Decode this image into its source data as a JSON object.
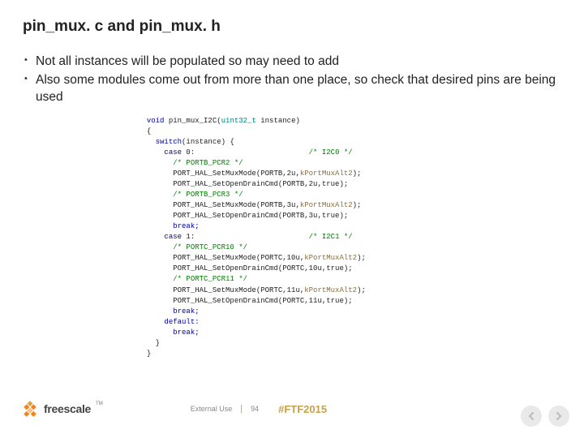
{
  "title": "pin_mux. c and pin_mux. h",
  "bullets": [
    "Not all instances will be populated so may need to add",
    "Also some modules come out from more than one place, so check that desired pins are being used"
  ],
  "code": {
    "l1a": "void",
    "l1b": " pin_mux_I2C(",
    "l1c": "uint32_t",
    "l1d": " instance)",
    "l2": "{",
    "l3a": "  switch",
    "l3b": "(instance) {",
    "l4a": "    case",
    "l4b": " 0:",
    "l4c": "                          /* I2C0 */",
    "l5": "      /* PORTB_PCR2 */",
    "l6a": "      PORT_HAL_SetMuxMode(PORTB,2u,",
    "l6b": "kPortMuxAlt2",
    "l6c": ");",
    "l7": "      PORT_HAL_SetOpenDrainCmd(PORTB,2u,true);",
    "l8": "      /* PORTB_PCR3 */",
    "l9a": "      PORT_HAL_SetMuxMode(PORTB,3u,",
    "l9b": "kPortMuxAlt2",
    "l9c": ");",
    "l10": "      PORT_HAL_SetOpenDrainCmd(PORTB,3u,true);",
    "l11": "      break;",
    "l12a": "    case",
    "l12b": " 1:",
    "l12c": "                          /* I2C1 */",
    "l13": "      /* PORTC_PCR10 */",
    "l14a": "      PORT_HAL_SetMuxMode(PORTC,10u,",
    "l14b": "kPortMuxAlt2",
    "l14c": ");",
    "l15": "      PORT_HAL_SetOpenDrainCmd(PORTC,10u,true);",
    "l16": "      /* PORTC_PCR11 */",
    "l17a": "      PORT_HAL_SetMuxMode(PORTC,11u,",
    "l17b": "kPortMuxAlt2",
    "l17c": ");",
    "l18": "      PORT_HAL_SetOpenDrainCmd(PORTC,11u,true);",
    "l19": "      break;",
    "l20": "    default:",
    "l21": "      break;",
    "l22": "  }",
    "l23": "}"
  },
  "footer": {
    "brand": "freescale",
    "tm": "TM",
    "external": "External Use",
    "page": "94",
    "hashtag": "#FTF2015"
  },
  "colors": {
    "accent": "#c8a24a",
    "logo_orange": "#f58220",
    "logo_gold": "#d9a441"
  }
}
